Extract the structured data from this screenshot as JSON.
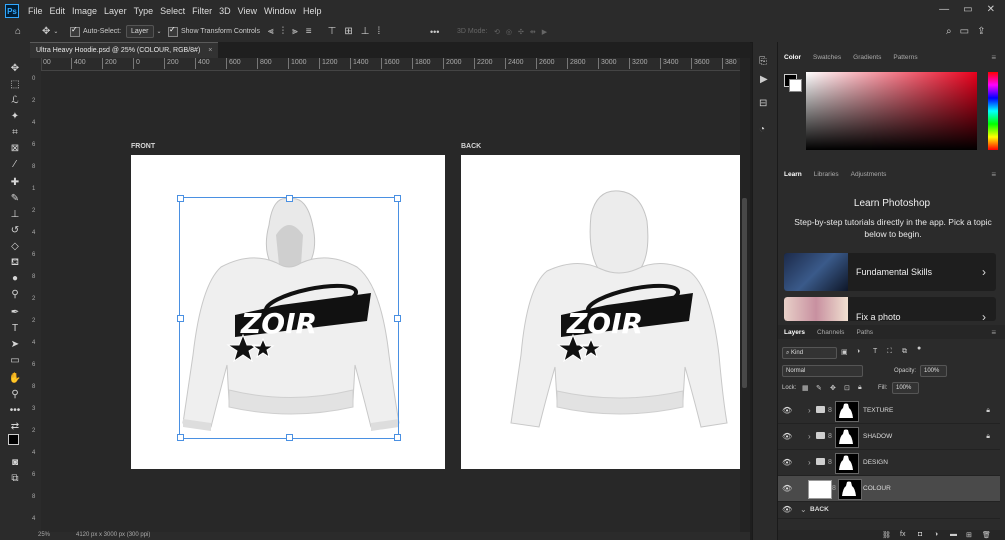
{
  "app": {
    "logo_text": "Ps"
  },
  "menu": [
    "File",
    "Edit",
    "Image",
    "Layer",
    "Type",
    "Select",
    "Filter",
    "3D",
    "View",
    "Window",
    "Help"
  ],
  "window_controls": [
    "—",
    "▭",
    "✕"
  ],
  "options": {
    "auto_select_label": "Auto-Select:",
    "auto_select_target": "Layer",
    "show_transform_label": "Show Transform Controls",
    "mode_3d_label": "3D Mode:",
    "more": "•••"
  },
  "document_tab": {
    "title": "Ultra Heavy Hoodie.psd @ 25% (COLOUR, RGB/8#)",
    "close": "×"
  },
  "ruler_ticks": [
    "00",
    "400",
    "200",
    "0",
    "200",
    "400",
    "600",
    "800",
    "1000",
    "1200",
    "1400",
    "1600",
    "1800",
    "2000",
    "2200",
    "2400",
    "2600",
    "2800",
    "3000",
    "3200",
    "3400",
    "3600",
    "380"
  ],
  "vruler_ticks": [
    "0",
    "2",
    "4",
    "6",
    "8",
    "1",
    "2",
    "4",
    "6",
    "8",
    "2",
    "2",
    "4",
    "6",
    "8",
    "3",
    "2",
    "4",
    "6",
    "8",
    "4"
  ],
  "artboards": {
    "front_label": "FRONT",
    "back_label": "BACK",
    "logo_text": "ZOIR"
  },
  "status": {
    "zoom": "25%",
    "doc_size": "4120 px x 3000 px (300 ppi)"
  },
  "color_panel": {
    "tabs": [
      "Color",
      "Swatches",
      "Gradients",
      "Patterns"
    ],
    "active": "Color"
  },
  "learn_panel": {
    "tabs": [
      "Learn",
      "Libraries",
      "Adjustments"
    ],
    "title": "Learn Photoshop",
    "subtitle": "Step-by-step tutorials directly in the app. Pick a topic below to begin.",
    "cards": [
      {
        "label": "Fundamental Skills"
      },
      {
        "label": "Fix a photo"
      }
    ]
  },
  "layers_panel": {
    "tabs": [
      "Layers",
      "Channels",
      "Paths"
    ],
    "filter_kind": "Kind",
    "blend_mode": "Normal",
    "opacity_label": "Opacity:",
    "opacity_value": "100%",
    "lock_label": "Lock:",
    "fill_label": "Fill:",
    "fill_value": "100%",
    "layers": [
      {
        "name": "TEXTURE",
        "type": "group",
        "locked": true
      },
      {
        "name": "SHADOW",
        "type": "group",
        "locked": true
      },
      {
        "name": "DESIGN",
        "type": "group",
        "locked": false
      },
      {
        "name": "COLOUR",
        "type": "layer",
        "locked": false,
        "selected": true
      },
      {
        "name": "BACK",
        "type": "group-open",
        "locked": false
      }
    ]
  },
  "colors": {
    "accent": "#31a8ff",
    "selection_bound": "#4a90e2",
    "canvas_bg": "#282828"
  }
}
